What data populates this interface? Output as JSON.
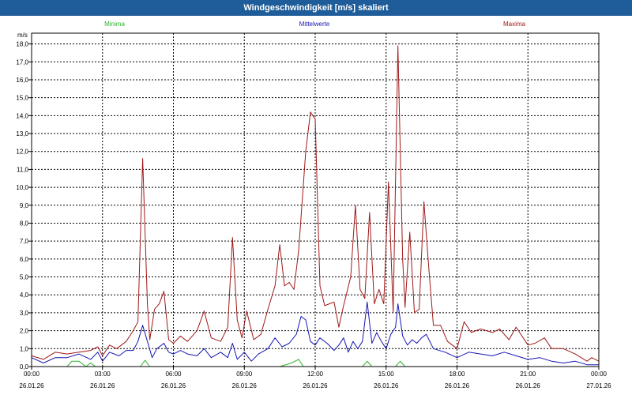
{
  "title": "Windgeschwindigkeit [m/s] skaliert",
  "colors": {
    "titlebar": "#1f5d9a",
    "minima": "#2db52d",
    "mittelwerte": "#1616b4",
    "maxima": "#a01818",
    "grid": "#000000"
  },
  "chart_data": {
    "type": "line",
    "title": "Windgeschwindigkeit [m/s] skaliert",
    "ylabel": "m/s",
    "ylim": [
      0,
      18.6
    ],
    "yticks": [
      "0,0",
      "1,0",
      "2,0",
      "3,0",
      "4,0",
      "5,0",
      "6,0",
      "7,0",
      "8,0",
      "9,0",
      "10,0",
      "11,0",
      "12,0",
      "13,0",
      "14,0",
      "15,0",
      "16,0",
      "17,0",
      "18,0"
    ],
    "xlim": [
      0,
      24
    ],
    "xticks": [
      {
        "time": "00:00",
        "date": "26.01.26"
      },
      {
        "time": "03:00",
        "date": "26.01.26"
      },
      {
        "time": "06:00",
        "date": "26.01.26"
      },
      {
        "time": "09:00",
        "date": "26.01.26"
      },
      {
        "time": "12:00",
        "date": "26.01.26"
      },
      {
        "time": "15:00",
        "date": "26.01.26"
      },
      {
        "time": "18:00",
        "date": "26.01.26"
      },
      {
        "time": "21:00",
        "date": "26.01.26"
      },
      {
        "time": "00:00",
        "date": "27.01.26"
      }
    ],
    "grid": true,
    "legend": "top",
    "series": [
      {
        "name": "Minima",
        "color": "#2db52d",
        "points": [
          [
            0,
            0
          ],
          [
            1.5,
            0
          ],
          [
            1.7,
            0.3
          ],
          [
            2.0,
            0.3
          ],
          [
            2.3,
            0
          ],
          [
            2.5,
            0.2
          ],
          [
            2.7,
            0
          ],
          [
            4.6,
            0
          ],
          [
            4.8,
            0.35
          ],
          [
            5.0,
            0
          ],
          [
            10.5,
            0
          ],
          [
            11.0,
            0.2
          ],
          [
            11.3,
            0.4
          ],
          [
            11.5,
            0
          ],
          [
            14.0,
            0
          ],
          [
            14.2,
            0.3
          ],
          [
            14.4,
            0
          ],
          [
            15.4,
            0
          ],
          [
            15.6,
            0.3
          ],
          [
            15.8,
            0
          ],
          [
            24,
            0
          ]
        ]
      },
      {
        "name": "Mittelwerte",
        "color": "#1616b4",
        "points": [
          [
            0,
            0.5
          ],
          [
            0.5,
            0.2
          ],
          [
            1.0,
            0.5
          ],
          [
            1.5,
            0.5
          ],
          [
            2.0,
            0.7
          ],
          [
            2.5,
            0.4
          ],
          [
            2.8,
            0.8
          ],
          [
            3.0,
            0.3
          ],
          [
            3.3,
            0.8
          ],
          [
            3.7,
            0.6
          ],
          [
            4.0,
            0.9
          ],
          [
            4.3,
            0.9
          ],
          [
            4.5,
            1.4
          ],
          [
            4.7,
            2.3
          ],
          [
            4.9,
            1.4
          ],
          [
            5.1,
            0.5
          ],
          [
            5.3,
            1.0
          ],
          [
            5.6,
            1.3
          ],
          [
            5.8,
            0.8
          ],
          [
            6.0,
            0.7
          ],
          [
            6.3,
            0.9
          ],
          [
            6.6,
            0.7
          ],
          [
            7.0,
            0.6
          ],
          [
            7.3,
            1.0
          ],
          [
            7.6,
            0.5
          ],
          [
            8.0,
            0.8
          ],
          [
            8.3,
            0.5
          ],
          [
            8.5,
            1.3
          ],
          [
            8.7,
            0.4
          ],
          [
            9.0,
            0.8
          ],
          [
            9.3,
            0.3
          ],
          [
            9.6,
            0.7
          ],
          [
            10.0,
            1.0
          ],
          [
            10.3,
            1.6
          ],
          [
            10.6,
            1.1
          ],
          [
            10.9,
            1.3
          ],
          [
            11.2,
            1.8
          ],
          [
            11.4,
            2.8
          ],
          [
            11.6,
            2.6
          ],
          [
            11.8,
            1.4
          ],
          [
            12.0,
            1.2
          ],
          [
            12.2,
            1.6
          ],
          [
            12.5,
            1.3
          ],
          [
            12.8,
            0.9
          ],
          [
            13.0,
            1.2
          ],
          [
            13.2,
            1.6
          ],
          [
            13.4,
            0.8
          ],
          [
            13.6,
            1.4
          ],
          [
            13.8,
            1.0
          ],
          [
            14.0,
            1.4
          ],
          [
            14.2,
            3.6
          ],
          [
            14.4,
            1.3
          ],
          [
            14.6,
            1.9
          ],
          [
            14.8,
            1.4
          ],
          [
            15.0,
            1.0
          ],
          [
            15.2,
            1.8
          ],
          [
            15.4,
            2.2
          ],
          [
            15.5,
            3.5
          ],
          [
            15.7,
            1.7
          ],
          [
            15.9,
            1.2
          ],
          [
            16.1,
            1.5
          ],
          [
            16.3,
            1.3
          ],
          [
            16.5,
            1.6
          ],
          [
            16.7,
            1.8
          ],
          [
            17.0,
            1.0
          ],
          [
            17.5,
            0.8
          ],
          [
            18.0,
            0.5
          ],
          [
            18.5,
            0.8
          ],
          [
            19.0,
            0.7
          ],
          [
            19.5,
            0.6
          ],
          [
            20.0,
            0.8
          ],
          [
            20.5,
            0.6
          ],
          [
            21.0,
            0.4
          ],
          [
            21.5,
            0.5
          ],
          [
            22.0,
            0.3
          ],
          [
            22.5,
            0.2
          ],
          [
            23.0,
            0.3
          ],
          [
            23.5,
            0.1
          ],
          [
            24,
            0.1
          ]
        ]
      },
      {
        "name": "Maxima",
        "color": "#a01818",
        "points": [
          [
            0,
            0.6
          ],
          [
            0.5,
            0.4
          ],
          [
            1.0,
            0.8
          ],
          [
            1.5,
            0.7
          ],
          [
            2.0,
            0.8
          ],
          [
            2.5,
            0.9
          ],
          [
            2.8,
            1.1
          ],
          [
            3.0,
            0.6
          ],
          [
            3.3,
            1.2
          ],
          [
            3.6,
            1.0
          ],
          [
            4.0,
            1.4
          ],
          [
            4.3,
            2.0
          ],
          [
            4.5,
            2.5
          ],
          [
            4.7,
            11.6
          ],
          [
            4.9,
            3.5
          ],
          [
            5.0,
            1.5
          ],
          [
            5.2,
            3.2
          ],
          [
            5.4,
            3.5
          ],
          [
            5.6,
            4.2
          ],
          [
            5.8,
            1.5
          ],
          [
            6.0,
            1.3
          ],
          [
            6.3,
            1.7
          ],
          [
            6.6,
            1.4
          ],
          [
            7.0,
            2.0
          ],
          [
            7.3,
            3.1
          ],
          [
            7.6,
            1.6
          ],
          [
            8.0,
            1.4
          ],
          [
            8.3,
            2.2
          ],
          [
            8.5,
            7.2
          ],
          [
            8.7,
            2.6
          ],
          [
            8.9,
            1.6
          ],
          [
            9.1,
            3.1
          ],
          [
            9.4,
            1.5
          ],
          [
            9.7,
            1.8
          ],
          [
            10.0,
            3.2
          ],
          [
            10.3,
            4.5
          ],
          [
            10.5,
            6.8
          ],
          [
            10.7,
            4.5
          ],
          [
            10.9,
            4.7
          ],
          [
            11.1,
            4.3
          ],
          [
            11.3,
            6.5
          ],
          [
            11.6,
            12.0
          ],
          [
            11.8,
            14.2
          ],
          [
            12.0,
            13.8
          ],
          [
            12.2,
            4.5
          ],
          [
            12.4,
            3.4
          ],
          [
            12.6,
            3.5
          ],
          [
            12.8,
            3.6
          ],
          [
            13.0,
            2.2
          ],
          [
            13.2,
            3.4
          ],
          [
            13.5,
            5.0
          ],
          [
            13.7,
            9.0
          ],
          [
            13.9,
            4.3
          ],
          [
            14.1,
            3.8
          ],
          [
            14.3,
            8.6
          ],
          [
            14.5,
            3.5
          ],
          [
            14.7,
            4.3
          ],
          [
            14.9,
            3.5
          ],
          [
            15.1,
            10.3
          ],
          [
            15.3,
            3.0
          ],
          [
            15.5,
            17.9
          ],
          [
            15.7,
            6.0
          ],
          [
            15.8,
            3.3
          ],
          [
            16.0,
            7.5
          ],
          [
            16.2,
            3.0
          ],
          [
            16.4,
            3.2
          ],
          [
            16.6,
            9.2
          ],
          [
            16.8,
            5.6
          ],
          [
            17.0,
            2.3
          ],
          [
            17.3,
            2.3
          ],
          [
            17.6,
            1.4
          ],
          [
            18.0,
            1.0
          ],
          [
            18.3,
            2.5
          ],
          [
            18.6,
            1.9
          ],
          [
            19.0,
            2.1
          ],
          [
            19.5,
            1.9
          ],
          [
            19.8,
            2.1
          ],
          [
            20.2,
            1.5
          ],
          [
            20.5,
            2.2
          ],
          [
            21.0,
            1.2
          ],
          [
            21.3,
            1.3
          ],
          [
            21.7,
            1.6
          ],
          [
            22.0,
            1.0
          ],
          [
            22.5,
            1.0
          ],
          [
            23.0,
            0.7
          ],
          [
            23.5,
            0.3
          ],
          [
            23.7,
            0.5
          ],
          [
            24,
            0.3
          ]
        ]
      }
    ]
  }
}
